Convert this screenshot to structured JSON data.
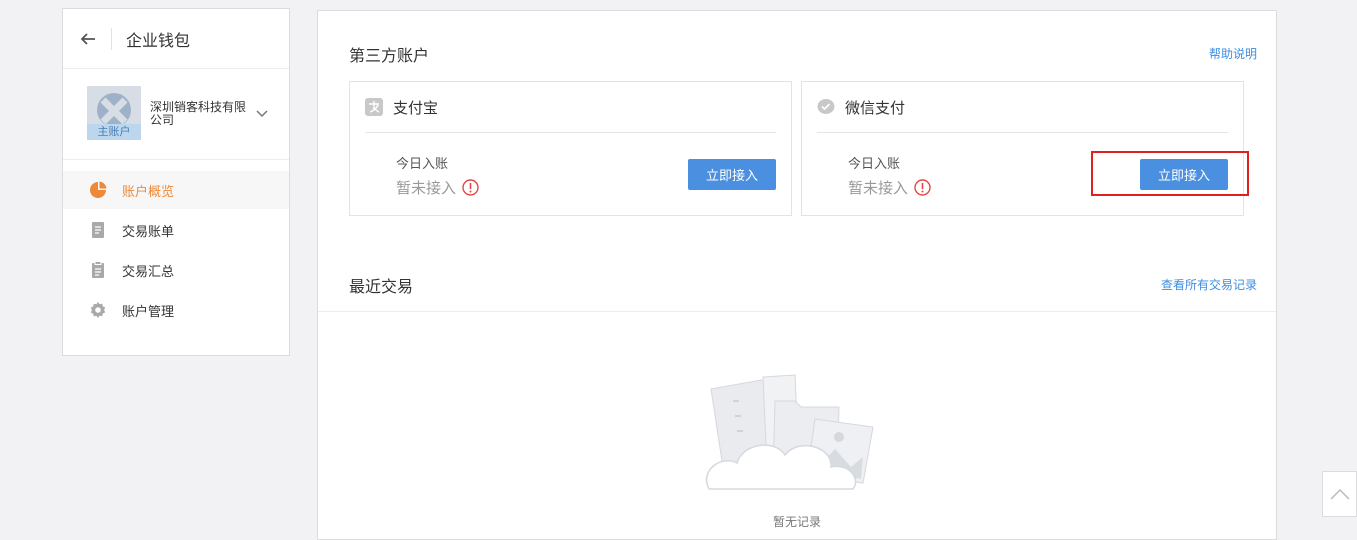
{
  "sidebar": {
    "title": "企业钱包",
    "account": {
      "company": "深圳销客科技有限公司",
      "badge": "主账户"
    },
    "items": [
      {
        "label": "账户概览",
        "icon": "pie-chart-icon",
        "active": true
      },
      {
        "label": "交易账单",
        "icon": "document-icon",
        "active": false
      },
      {
        "label": "交易汇总",
        "icon": "clipboard-icon",
        "active": false
      },
      {
        "label": "账户管理",
        "icon": "gear-icon",
        "active": false
      }
    ]
  },
  "third_party": {
    "title": "第三方账户",
    "help_link": "帮助说明",
    "cards": [
      {
        "name": "支付宝",
        "icon": "alipay-icon",
        "today_label": "今日入账",
        "status": "暂未接入",
        "button": "立即接入"
      },
      {
        "name": "微信支付",
        "icon": "wechat-pay-icon",
        "today_label": "今日入账",
        "status": "暂未接入",
        "button": "立即接入"
      }
    ]
  },
  "recent": {
    "title": "最近交易",
    "link": "查看所有交易记录",
    "empty_text": "暂无记录"
  },
  "colors": {
    "accent": "#4a8fe0",
    "active_nav": "#ed8a3a",
    "highlight": "#e02020",
    "warning": "#e64545"
  }
}
